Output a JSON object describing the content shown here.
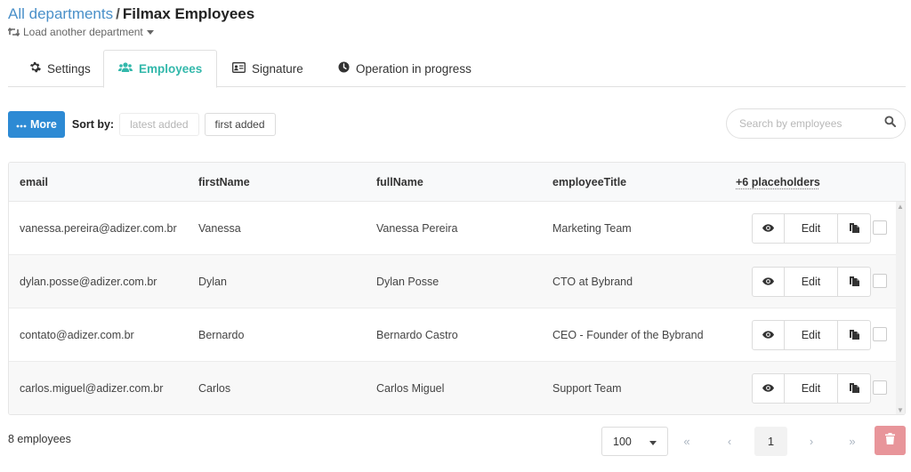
{
  "breadcrumb": {
    "parent": "All departments",
    "separator": "/",
    "current": "Filmax Employees"
  },
  "load_department": {
    "label": "Load another department",
    "icon": "retweet-icon"
  },
  "tabs": [
    {
      "label": "Settings",
      "icon": "gear-icon",
      "active": false
    },
    {
      "label": "Employees",
      "icon": "users-icon",
      "active": true
    },
    {
      "label": "Signature",
      "icon": "id-card-icon",
      "active": false
    },
    {
      "label": "Operation in progress",
      "icon": "clock-icon",
      "active": false
    }
  ],
  "toolbar": {
    "more_label": "More",
    "sort_by_label": "Sort by:",
    "sort_options": [
      "latest added",
      "first added"
    ]
  },
  "search": {
    "placeholder": "Search by employees",
    "value": ""
  },
  "table": {
    "columns": [
      "email",
      "firstName",
      "fullName",
      "employeeTitle",
      "+6 placeholders"
    ],
    "rows": [
      {
        "email": "vanessa.pereira@adizer.com.br",
        "firstName": "Vanessa",
        "fullName": "Vanessa Pereira",
        "employeeTitle": "Marketing Team"
      },
      {
        "email": "dylan.posse@adizer.com.br",
        "firstName": "Dylan",
        "fullName": "Dylan Posse",
        "employeeTitle": "CTO at Bybrand"
      },
      {
        "email": "contato@adizer.com.br",
        "firstName": "Bernardo",
        "fullName": "Bernardo Castro",
        "employeeTitle": "CEO - Founder of the Bybrand"
      },
      {
        "email": "carlos.miguel@adizer.com.br",
        "firstName": "Carlos",
        "fullName": "Carlos Miguel",
        "employeeTitle": "Support Team"
      }
    ],
    "row_actions": {
      "edit_label": "Edit"
    }
  },
  "footer": {
    "count_label": "8 employees",
    "page_size": "100",
    "pager": {
      "first": "«",
      "prev": "‹",
      "current": "1",
      "next": "›",
      "last": "»"
    }
  },
  "colors": {
    "primary": "#2d8ad4",
    "tab_active": "#33b8ab",
    "link": "#4a90c9",
    "danger": "#e8959a"
  }
}
